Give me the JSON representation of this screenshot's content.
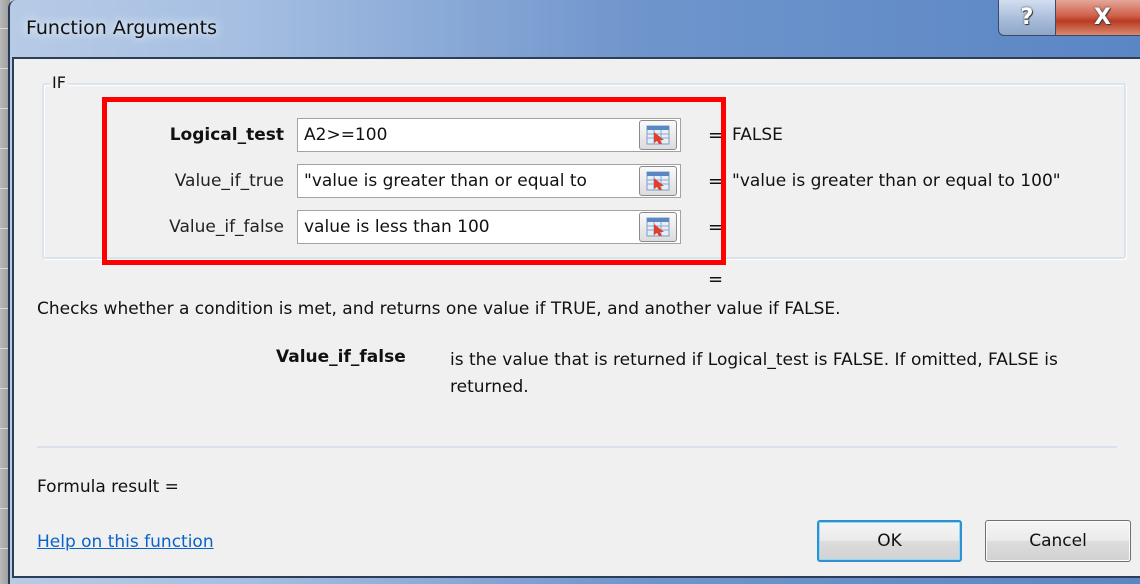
{
  "window": {
    "title": "Function Arguments",
    "help_glyph": "?",
    "close_glyph": "X"
  },
  "function_group": {
    "name": "IF",
    "arguments": [
      {
        "label": "Logical_test",
        "bold": true,
        "value": "A2>=100",
        "equals": "=",
        "result": "FALSE"
      },
      {
        "label": "Value_if_true",
        "bold": false,
        "value": "\"value is greater than or equal to",
        "equals": "=",
        "result": "\"value is greater than or equal to 100\""
      },
      {
        "label": "Value_if_false",
        "bold": false,
        "value": "value is less than 100",
        "equals": "=",
        "result": ""
      }
    ],
    "overall_equals": "="
  },
  "description": "Checks whether a condition is met, and returns one value if TRUE, and another value if FALSE.",
  "argument_help": {
    "name": "Value_if_false",
    "text": "is the value that is returned if Logical_test is FALSE. If omitted, FALSE is returned."
  },
  "formula_result": {
    "label": "Formula result =",
    "value": ""
  },
  "help_link": "Help on this function",
  "buttons": {
    "ok": "OK",
    "cancel": "Cancel"
  },
  "colors": {
    "highlight": "#ff0000",
    "link": "#0b62c8",
    "ok_focus_border": "#2f8fd0"
  }
}
